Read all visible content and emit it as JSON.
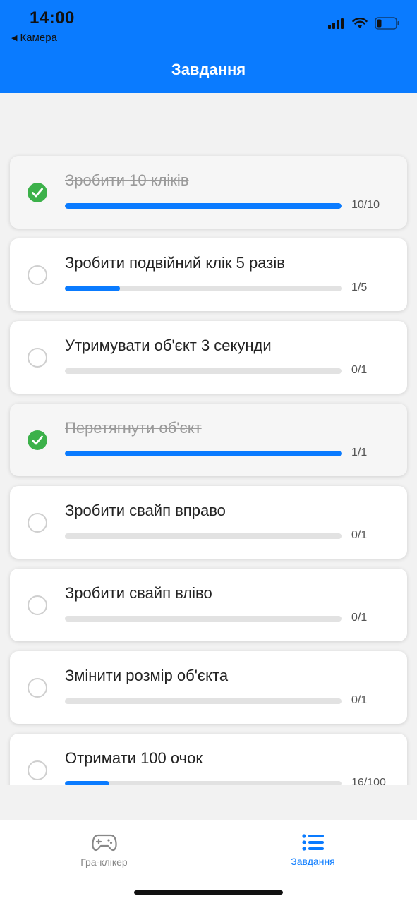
{
  "status_bar": {
    "time": "14:00",
    "back_label": "Камера"
  },
  "header": {
    "title": "Завдання"
  },
  "tasks": [
    {
      "title": "Зробити 10 кліків",
      "count": "10/10",
      "progress": 1.0,
      "done": true
    },
    {
      "title": "Зробити подвійний клік 5 разів",
      "count": "1/5",
      "progress": 0.2,
      "done": false
    },
    {
      "title": "Утримувати об'єкт 3 секунди",
      "count": "0/1",
      "progress": 0,
      "done": false
    },
    {
      "title": "Перетягнути об'єкт",
      "count": "1/1",
      "progress": 1.0,
      "done": true
    },
    {
      "title": "Зробити свайп вправо",
      "count": "0/1",
      "progress": 0,
      "done": false
    },
    {
      "title": "Зробити свайп вліво",
      "count": "0/1",
      "progress": 0,
      "done": false
    },
    {
      "title": "Змінити розмір об'єкта",
      "count": "0/1",
      "progress": 0,
      "done": false
    },
    {
      "title": "Отримати 100 очок",
      "count": "16/100",
      "progress": 0.16,
      "done": false
    }
  ],
  "tabs": [
    {
      "label": "Гра-клікер",
      "icon": "gamepad-icon",
      "active": false
    },
    {
      "label": "Завдання",
      "icon": "list-icon",
      "active": true
    }
  ],
  "colors": {
    "accent": "#0a7bff",
    "done_green": "#3cb14a",
    "track": "#e2e2e2"
  }
}
